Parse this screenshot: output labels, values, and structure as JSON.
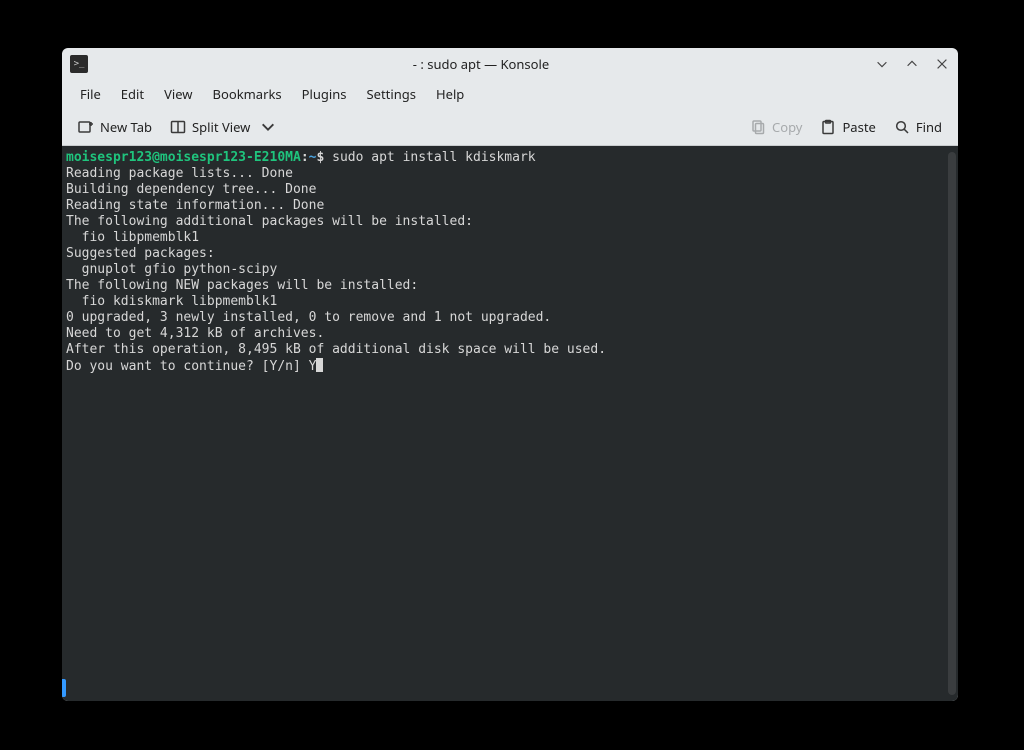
{
  "titlebar": {
    "title": "- : sudo apt — Konsole"
  },
  "menubar": {
    "file": "File",
    "edit": "Edit",
    "view": "View",
    "bookmarks": "Bookmarks",
    "plugins": "Plugins",
    "settings": "Settings",
    "help": "Help"
  },
  "toolbar": {
    "new_tab": "New Tab",
    "split_view": "Split View",
    "copy": "Copy",
    "paste": "Paste",
    "find": "Find"
  },
  "terminal": {
    "prompt_user": "moisespr123@moisespr123-E210MA",
    "prompt_path": "~",
    "command": "sudo apt install kdiskmark",
    "lines": [
      "Reading package lists... Done",
      "Building dependency tree... Done",
      "Reading state information... Done",
      "The following additional packages will be installed:",
      "  fio libpmemblk1",
      "Suggested packages:",
      "  gnuplot gfio python-scipy",
      "The following NEW packages will be installed:",
      "  fio kdiskmark libpmemblk1",
      "0 upgraded, 3 newly installed, 0 to remove and 1 not upgraded.",
      "Need to get 4,312 kB of archives.",
      "After this operation, 8,495 kB of additional disk space will be used."
    ],
    "prompt_question": "Do you want to continue? [Y/n] ",
    "input_answer": "Y"
  }
}
